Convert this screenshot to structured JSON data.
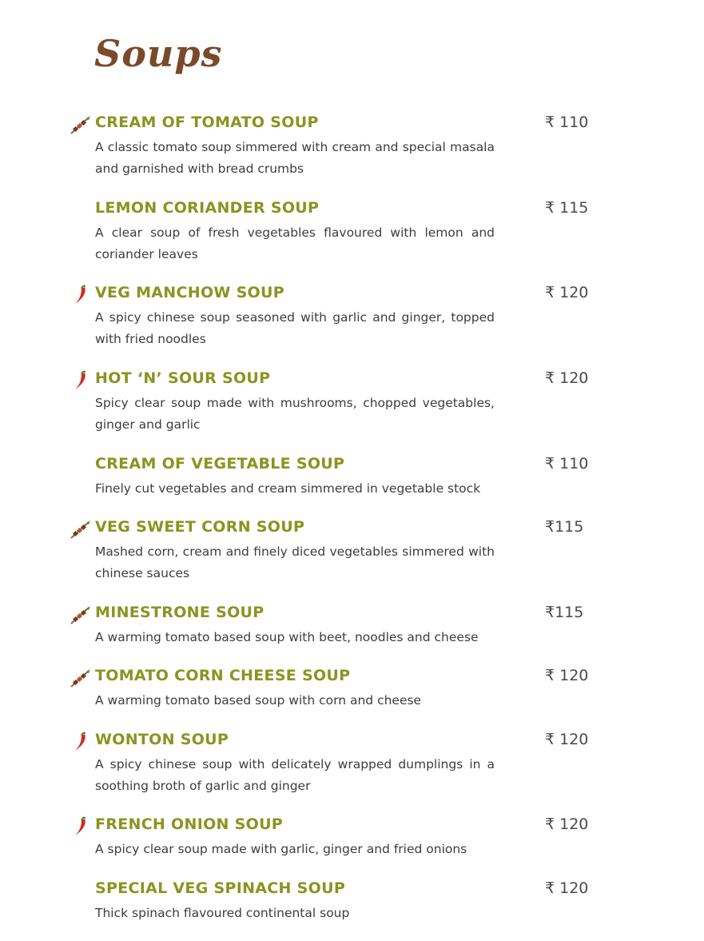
{
  "page": {
    "title": "Soups"
  },
  "colors": {
    "title": "#7a4a2a",
    "item_name": "#8a9420",
    "text": "#3d3d3d",
    "chili": "#d42a1c",
    "stem": "#4a8a2a"
  },
  "items": [
    {
      "name": "CREAM OF TOMATO SOUP",
      "description": "A classic tomato soup simmered with cream and special masala and garnished with bread crumbs",
      "price": "₹ 110",
      "icon": "kebab-skewer-icon"
    },
    {
      "name": "LEMON CORIANDER SOUP",
      "description": "A clear soup of fresh vegetables flavoured with lemon and coriander leaves",
      "price": "₹ 115",
      "icon": ""
    },
    {
      "name": "VEG MANCHOW SOUP",
      "description": "A spicy chinese soup seasoned with garlic and ginger, topped with fried noodles",
      "price": "₹ 120",
      "icon": "chili-pepper-icon"
    },
    {
      "name": "HOT ‘N’ SOUR SOUP",
      "description": "Spicy clear soup made with mushrooms, chopped vegetables, ginger and garlic",
      "price": "₹ 120",
      "icon": "chili-pepper-icon"
    },
    {
      "name": "CREAM OF VEGETABLE SOUP",
      "description": "Finely cut vegetables and cream simmered in vegetable stock",
      "price": "₹ 110",
      "icon": ""
    },
    {
      "name": "VEG SWEET CORN SOUP",
      "description": "Mashed corn, cream and finely diced vegetables simmered with chinese sauces",
      "price": "₹115",
      "icon": "kebab-skewer-icon"
    },
    {
      "name": "MINESTRONE SOUP",
      "description": "A warming tomato based soup with beet, noodles and cheese",
      "price": "₹115",
      "icon": "kebab-skewer-icon"
    },
    {
      "name": "TOMATO CORN CHEESE SOUP",
      "description": "A warming tomato based soup with corn and cheese",
      "price": "₹ 120",
      "icon": "kebab-skewer-icon"
    },
    {
      "name": "WONTON SOUP",
      "description": "A spicy chinese soup with delicately wrapped dumplings in a soothing broth of garlic and ginger",
      "price": "₹ 120",
      "icon": "chili-pepper-icon"
    },
    {
      "name": "FRENCH ONION SOUP",
      "description": "A spicy clear soup made with garlic, ginger and fried onions",
      "price": "₹ 120",
      "icon": "chili-pepper-icon"
    },
    {
      "name": "SPECIAL VEG SPINACH SOUP",
      "description": "Thick spinach flavoured continental soup",
      "price": "₹ 120",
      "icon": ""
    }
  ]
}
